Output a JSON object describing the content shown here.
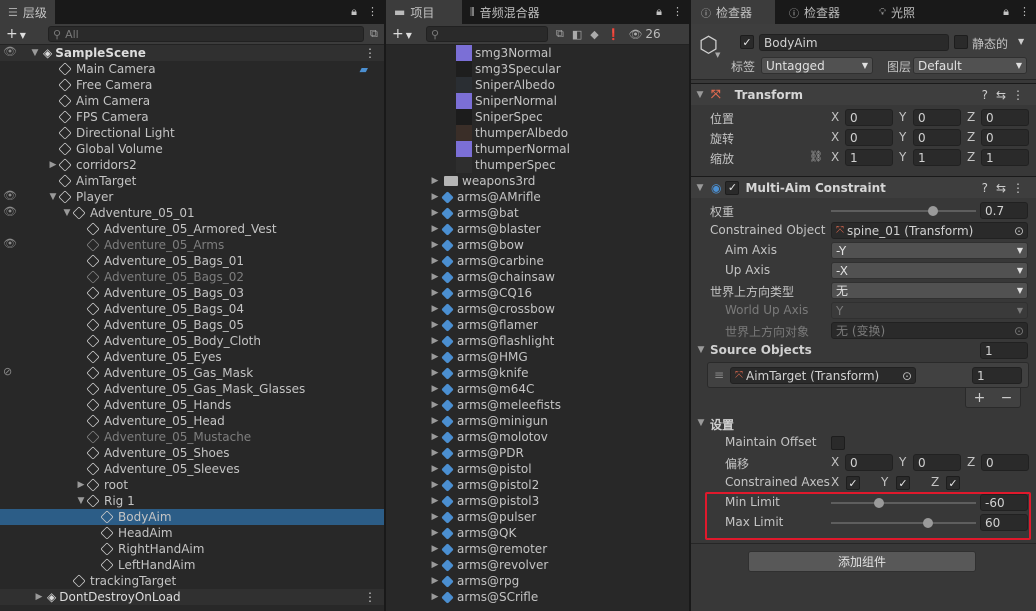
{
  "hierarchy": {
    "tab_label": "层级",
    "search_placeholder": "All",
    "scene": "SampleScene",
    "items": [
      {
        "label": "Main Camera",
        "indent": 1,
        "arrow": ""
      },
      {
        "label": "Free Camera",
        "indent": 1,
        "arrow": ""
      },
      {
        "label": "Aim Camera",
        "indent": 1,
        "arrow": ""
      },
      {
        "label": "FPS Camera",
        "indent": 1,
        "arrow": ""
      },
      {
        "label": "Directional Light",
        "indent": 1,
        "arrow": ""
      },
      {
        "label": "Global Volume",
        "indent": 1,
        "arrow": ""
      },
      {
        "label": "corridors2",
        "indent": 1,
        "arrow": "▶"
      },
      {
        "label": "AimTarget",
        "indent": 1,
        "arrow": ""
      },
      {
        "label": "Player",
        "indent": 1,
        "arrow": "▼"
      },
      {
        "label": "Adventure_05_01",
        "indent": 2,
        "arrow": "▼"
      },
      {
        "label": "Adventure_05_Armored_Vest",
        "indent": 3,
        "arrow": ""
      },
      {
        "label": "Adventure_05_Arms",
        "indent": 3,
        "arrow": "",
        "dim": true
      },
      {
        "label": "Adventure_05_Bags_01",
        "indent": 3,
        "arrow": ""
      },
      {
        "label": "Adventure_05_Bags_02",
        "indent": 3,
        "arrow": "",
        "dim": true
      },
      {
        "label": "Adventure_05_Bags_03",
        "indent": 3,
        "arrow": ""
      },
      {
        "label": "Adventure_05_Bags_04",
        "indent": 3,
        "arrow": ""
      },
      {
        "label": "Adventure_05_Bags_05",
        "indent": 3,
        "arrow": ""
      },
      {
        "label": "Adventure_05_Body_Cloth",
        "indent": 3,
        "arrow": ""
      },
      {
        "label": "Adventure_05_Eyes",
        "indent": 3,
        "arrow": ""
      },
      {
        "label": "Adventure_05_Gas_Mask",
        "indent": 3,
        "arrow": ""
      },
      {
        "label": "Adventure_05_Gas_Mask_Glasses",
        "indent": 3,
        "arrow": ""
      },
      {
        "label": "Adventure_05_Hands",
        "indent": 3,
        "arrow": ""
      },
      {
        "label": "Adventure_05_Head",
        "indent": 3,
        "arrow": ""
      },
      {
        "label": "Adventure_05_Mustache",
        "indent": 3,
        "arrow": "",
        "dim": true
      },
      {
        "label": "Adventure_05_Shoes",
        "indent": 3,
        "arrow": ""
      },
      {
        "label": "Adventure_05_Sleeves",
        "indent": 3,
        "arrow": ""
      },
      {
        "label": "root",
        "indent": 3,
        "arrow": "▶"
      },
      {
        "label": "Rig 1",
        "indent": 3,
        "arrow": "▼"
      },
      {
        "label": "BodyAim",
        "indent": 4,
        "arrow": "",
        "selected": true
      },
      {
        "label": "HeadAim",
        "indent": 4,
        "arrow": ""
      },
      {
        "label": "RightHandAim",
        "indent": 4,
        "arrow": ""
      },
      {
        "label": "LeftHandAim",
        "indent": 4,
        "arrow": ""
      },
      {
        "label": "trackingTarget",
        "indent": 2,
        "arrow": ""
      }
    ],
    "bottom_scene": "DontDestroyOnLoad"
  },
  "project": {
    "tab_label": "项目",
    "tab2_label": "音频混合器",
    "hidden_count": "26",
    "textures": [
      {
        "label": "smg3Normal",
        "color": "#7b6fd6"
      },
      {
        "label": "smg3Specular",
        "color": "#1e1e1e"
      },
      {
        "label": "SniperAlbedo",
        "color": "#2a2e33"
      },
      {
        "label": "SniperNormal",
        "color": "#7b6fd6"
      },
      {
        "label": "SniperSpec",
        "color": "#1c1c1c"
      },
      {
        "label": "thumperAlbedo",
        "color": "#3a2e28"
      },
      {
        "label": "thumperNormal",
        "color": "#7b6fd6"
      },
      {
        "label": "thumperSpec",
        "color": "#2e2e2e"
      }
    ],
    "folder": "weapons3rd",
    "models": [
      "arms@AMrifle",
      "arms@bat",
      "arms@blaster",
      "arms@bow",
      "arms@carbine",
      "arms@chainsaw",
      "arms@CQ16",
      "arms@crossbow",
      "arms@flamer",
      "arms@flashlight",
      "arms@HMG",
      "arms@knife",
      "arms@m64C",
      "arms@meleefists",
      "arms@minigun",
      "arms@molotov",
      "arms@PDR",
      "arms@pistol",
      "arms@pistol2",
      "arms@pistol3",
      "arms@pulser",
      "arms@QK",
      "arms@remoter",
      "arms@revolver",
      "arms@rpg",
      "arms@SCrifle"
    ]
  },
  "inspector": {
    "tab1": "检查器",
    "tab2": "检查器",
    "tab3": "光照",
    "object_name": "BodyAim",
    "static_label": "静态的",
    "tag_label": "标签",
    "tag_value": "Untagged",
    "layer_label": "图层",
    "layer_value": "Default",
    "transform": {
      "title": "Transform",
      "position_label": "位置",
      "rotation_label": "旋转",
      "scale_label": "缩放",
      "position": [
        "0",
        "0",
        "0"
      ],
      "rotation": [
        "0",
        "0",
        "0"
      ],
      "scale": [
        "1",
        "1",
        "1"
      ]
    },
    "constraint": {
      "title": "Multi-Aim Constraint",
      "weight_label": "权重",
      "weight": "0.7",
      "weight_fraction": 0.7,
      "constrained_object_label": "Constrained Object",
      "constrained_object": "spine_01 (Transform)",
      "aim_axis_label": "Aim Axis",
      "aim_axis": "-Y",
      "up_axis_label": "Up Axis",
      "up_axis": "-X",
      "world_up_type_label": "世界上方向类型",
      "world_up_type": "无",
      "world_up_axis_label": "World Up Axis",
      "world_up_axis": "Y",
      "world_up_object_label": "世界上方向对象",
      "world_up_object": "无 (变换)",
      "source_objects_label": "Source Objects",
      "source_count": "1",
      "source_item": "AimTarget (Transform)",
      "source_weight": "1",
      "settings_label": "设置",
      "maintain_offset_label": "Maintain Offset",
      "offset_label": "偏移",
      "offset": [
        "0",
        "0",
        "0"
      ],
      "constrained_axes_label": "Constrained Axes",
      "min_limit_label": "Min Limit",
      "min_limit": "-60",
      "min_fraction": 0.333,
      "max_limit_label": "Max Limit",
      "max_limit": "60",
      "max_fraction": 0.667
    },
    "add_component": "添加组件"
  },
  "colors": {
    "selection": "#2c5d87",
    "highlight_box": "#e0192c",
    "accent": "#4b8fd1"
  }
}
